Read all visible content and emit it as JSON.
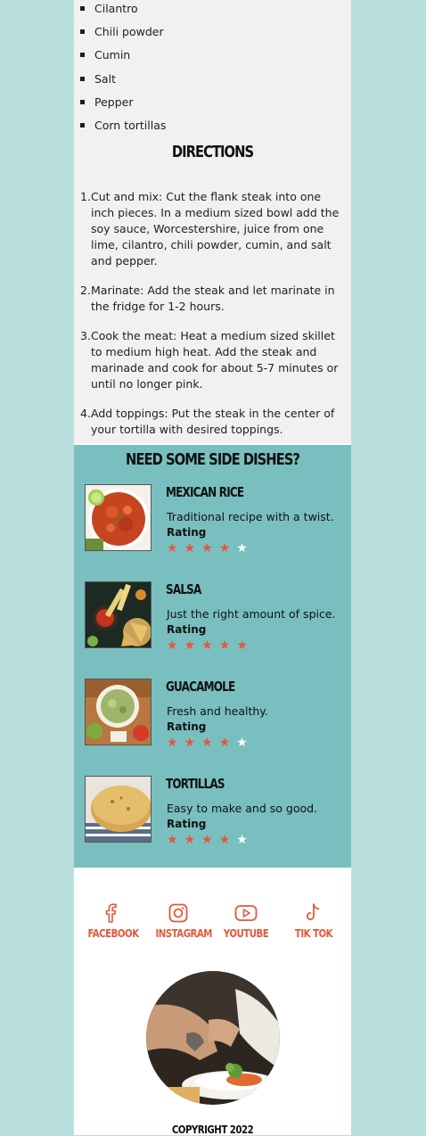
{
  "ingredients": [
    "Cilantro",
    "Chili powder",
    "Cumin",
    "Salt",
    "Pepper",
    "Corn tortillas"
  ],
  "directions": {
    "title": "DIRECTIONS",
    "steps": [
      {
        "num": "1.",
        "text": "Cut and mix: Cut the flank steak into one inch pieces. In a medium sized bowl add the soy sauce, Worcestershire, juice from one lime, cilantro, chili powder, cumin, and salt and pepper."
      },
      {
        "num": "2.",
        "text": "Marinate: Add the steak and let marinate in the fridge for 1-2 hours."
      },
      {
        "num": "3.",
        "text": "Cook the meat: Heat a medium sized skillet to medium high heat. Add the steak and marinade and cook for about 5-7 minutes or until no longer pink."
      },
      {
        "num": "4.",
        "text": "Add toppings: Put the steak in the center of your tortilla with desired toppings."
      }
    ]
  },
  "sides": {
    "title": "NEED SOME SIDE DISHES?",
    "rating_label": "Rating",
    "dishes": [
      {
        "name": "MEXICAN RICE",
        "desc": "Traditional recipe with a twist.",
        "rating": 4,
        "max": 5
      },
      {
        "name": "SALSA",
        "desc": "Just the right amount of spice.",
        "rating": 5,
        "max": 5
      },
      {
        "name": "GUACAMOLE",
        "desc": "Fresh and healthy.",
        "rating": 4,
        "max": 5
      },
      {
        "name": "TORTILLAS",
        "desc": "Easy to make and so good.",
        "rating": 4,
        "max": 5
      }
    ]
  },
  "social": [
    {
      "label": "FACEBOOK",
      "icon": "facebook-icon"
    },
    {
      "label": "INSTAGRAM",
      "icon": "instagram-icon"
    },
    {
      "label": "YOUTUBE",
      "icon": "youtube-icon"
    },
    {
      "label": "TIK TOK",
      "icon": "tiktok-icon"
    }
  ],
  "footer": {
    "copyright": "COPYRIGHT 2022"
  },
  "colors": {
    "accent": "#e2583a",
    "teal": "#79bfbf",
    "background": "#b9dfdf"
  }
}
